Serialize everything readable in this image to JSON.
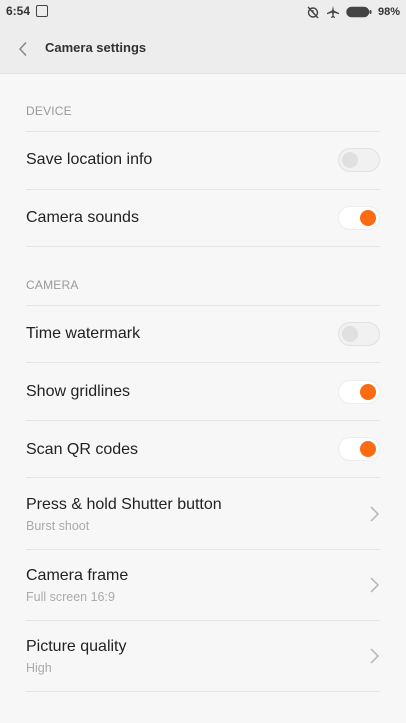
{
  "status": {
    "time": "6:54",
    "battery": "98%"
  },
  "header": {
    "title": "Camera settings"
  },
  "sections": {
    "device": "DEVICE",
    "camera": "CAMERA"
  },
  "settings": {
    "save_location": {
      "label": "Save location info",
      "enabled": false
    },
    "camera_sounds": {
      "label": "Camera sounds",
      "enabled": true
    },
    "time_watermark": {
      "label": "Time watermark",
      "enabled": false
    },
    "show_gridlines": {
      "label": "Show gridlines",
      "enabled": true
    },
    "scan_qr": {
      "label": "Scan QR codes",
      "enabled": true
    },
    "press_hold": {
      "label": "Press & hold Shutter button",
      "value": "Burst shoot"
    },
    "camera_frame": {
      "label": "Camera frame",
      "value": "Full screen 16:9"
    },
    "picture_quality": {
      "label": "Picture quality",
      "value": "High"
    }
  },
  "colors": {
    "accent": "#fa6b12",
    "toggle_off": "#e0e0e0"
  }
}
